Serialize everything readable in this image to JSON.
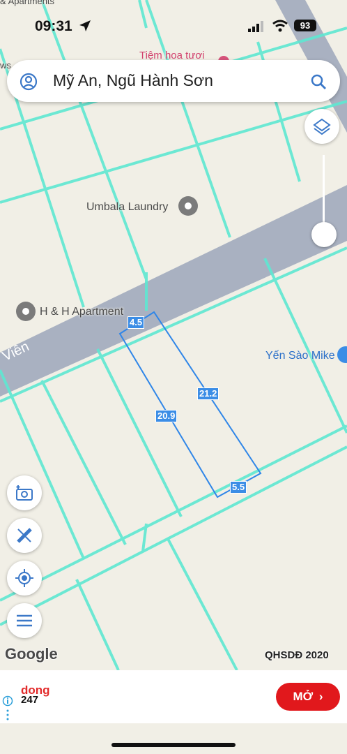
{
  "status_bar": {
    "time": "09:31",
    "battery": "93"
  },
  "search": {
    "query": "Mỹ An, Ngũ Hành Sơn"
  },
  "map_labels": {
    "top_place": "Tiệm hoa tươi",
    "laundry": "Umbala Laundry",
    "apartment": "H & H Apartment",
    "road": "Viên",
    "shop": "Yến Sào Mike",
    "left_edge": "ws",
    "top_left": "& Apartments"
  },
  "parcel": {
    "side_top": "4.5",
    "side_right": "21.2",
    "side_left": "20.9",
    "side_bottom": "5.5"
  },
  "map_footer": {
    "logo": "Google",
    "layer_name": "QHSDĐ 2020"
  },
  "ad": {
    "brand_top": "dong",
    "brand_bottom": "247",
    "cta": "MỞ",
    "info_icon": "info-icon"
  },
  "colors": {
    "parcel_line": "#2f86e8",
    "plan_line": "#5ee8d2",
    "road": "#a9b1c1"
  }
}
